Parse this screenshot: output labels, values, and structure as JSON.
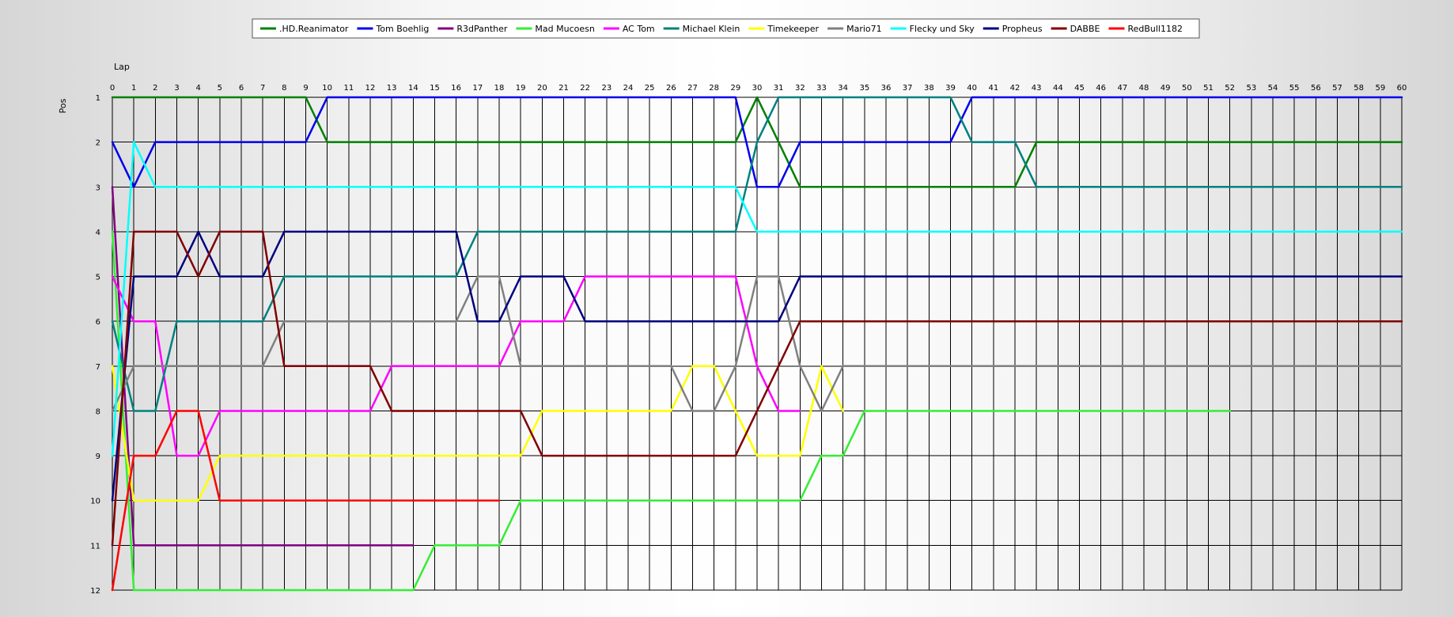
{
  "chart_data": {
    "type": "line",
    "xlabel": "Lap",
    "ylabel": "Pos",
    "xlim": [
      0,
      60
    ],
    "ylim": [
      1,
      12
    ],
    "y_inverted": true,
    "grid": true,
    "legend_position": "top",
    "x_ticks": [
      0,
      1,
      2,
      3,
      4,
      5,
      6,
      7,
      8,
      9,
      10,
      11,
      12,
      13,
      14,
      15,
      16,
      17,
      18,
      19,
      20,
      21,
      22,
      23,
      24,
      25,
      26,
      27,
      28,
      29,
      30,
      31,
      32,
      33,
      34,
      35,
      36,
      37,
      38,
      39,
      40,
      41,
      42,
      43,
      44,
      45,
      46,
      47,
      48,
      49,
      50,
      51,
      52,
      53,
      54,
      55,
      56,
      57,
      58,
      59,
      60
    ],
    "y_ticks": [
      1,
      2,
      3,
      4,
      5,
      6,
      7,
      8,
      9,
      10,
      11,
      12
    ],
    "series": [
      {
        "name": ".HD.Reanimator",
        "color": "#008000",
        "x": [
          0,
          9,
          10,
          29,
          30,
          31,
          32,
          42,
          43,
          60
        ],
        "y": [
          1,
          1,
          2,
          2,
          1,
          2,
          3,
          3,
          2,
          2
        ]
      },
      {
        "name": "Tom Boehlig",
        "color": "#0000ee",
        "x": [
          0,
          1,
          2,
          9,
          10,
          29,
          30,
          31,
          32,
          39,
          40,
          60
        ],
        "y": [
          2,
          3,
          2,
          2,
          1,
          1,
          3,
          3,
          2,
          2,
          1,
          1
        ]
      },
      {
        "name": "R3dPanther",
        "color": "#800080",
        "x": [
          0,
          1,
          14
        ],
        "y": [
          3,
          11,
          11
        ]
      },
      {
        "name": "Mad Mucoesn",
        "color": "#33ee33",
        "x": [
          0,
          1,
          14,
          15,
          18,
          19,
          32,
          33,
          34,
          35,
          52
        ],
        "y": [
          4,
          12,
          12,
          11,
          11,
          10,
          10,
          9,
          9,
          8,
          8
        ]
      },
      {
        "name": "AC Tom",
        "color": "#ff00ff",
        "x": [
          0,
          1,
          2,
          3,
          4,
          5,
          12,
          13,
          18,
          19,
          21,
          22,
          29,
          30,
          31,
          32
        ],
        "y": [
          5,
          6,
          6,
          9,
          9,
          8,
          8,
          7,
          7,
          6,
          6,
          5,
          5,
          7,
          8,
          8
        ]
      },
      {
        "name": "Michael Klein",
        "color": "#008080",
        "x": [
          0,
          1,
          2,
          3,
          7,
          8,
          16,
          17,
          29,
          30,
          31,
          39,
          40,
          42,
          43,
          60
        ],
        "y": [
          6,
          8,
          8,
          6,
          6,
          5,
          5,
          4,
          4,
          2,
          1,
          1,
          2,
          2,
          3,
          3
        ]
      },
      {
        "name": "Timekeeper",
        "color": "#ffff00",
        "x": [
          0,
          1,
          4,
          5,
          19,
          20,
          26,
          27,
          28,
          29,
          30,
          32,
          33,
          34
        ],
        "y": [
          7,
          10,
          10,
          9,
          9,
          8,
          8,
          7,
          7,
          8,
          9,
          9,
          7,
          8
        ]
      },
      {
        "name": "Mario71",
        "color": "#808080",
        "x": [
          0,
          1,
          7,
          8,
          16,
          17,
          18,
          19,
          26,
          27,
          28,
          29,
          30,
          31,
          32,
          33,
          34,
          60
        ],
        "y": [
          8,
          7,
          7,
          6,
          6,
          5,
          5,
          7,
          7,
          8,
          8,
          7,
          5,
          5,
          7,
          8,
          7,
          7
        ]
      },
      {
        "name": "Flecky und Sky",
        "color": "#00ffff",
        "x": [
          0,
          1,
          2,
          29,
          30,
          60
        ],
        "y": [
          9,
          2,
          3,
          3,
          4,
          4
        ]
      },
      {
        "name": "Propheus",
        "color": "#000080",
        "x": [
          0,
          1,
          3,
          4,
          5,
          7,
          8,
          16,
          17,
          18,
          19,
          21,
          22,
          31,
          32,
          60
        ],
        "y": [
          10,
          5,
          5,
          4,
          5,
          5,
          4,
          4,
          6,
          6,
          5,
          5,
          6,
          6,
          5,
          5
        ]
      },
      {
        "name": "DABBE",
        "color": "#800000",
        "x": [
          0,
          1,
          3,
          4,
          5,
          7,
          8,
          12,
          13,
          19,
          20,
          29,
          32,
          60
        ],
        "y": [
          11,
          4,
          4,
          5,
          4,
          4,
          7,
          7,
          8,
          8,
          9,
          9,
          6,
          6
        ]
      },
      {
        "name": "RedBull1182",
        "color": "#ff0000",
        "x": [
          0,
          1,
          2,
          3,
          4,
          5,
          18
        ],
        "y": [
          12,
          9,
          9,
          8,
          8,
          10,
          10
        ]
      }
    ]
  }
}
